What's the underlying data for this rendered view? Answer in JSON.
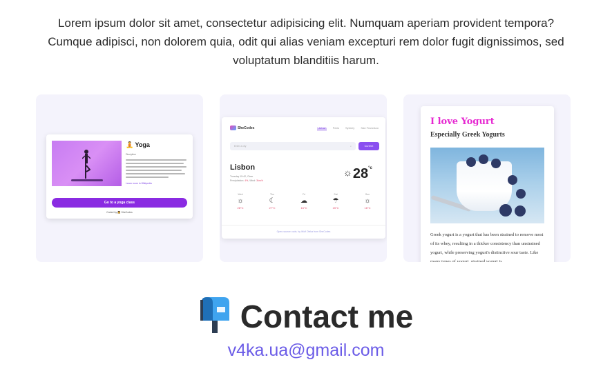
{
  "intro": {
    "text": "Lorem ipsum dolor sit amet, consectetur adipisicing elit. Numquam aperiam provident tempora? Cumque adipisci, non dolorem quia, odit qui alias veniam excepturi rem dolor fugit dignissimos, sed voluptatum blanditiis harum."
  },
  "projects": {
    "yoga": {
      "title": "🧘 Yoga",
      "subtitle": "Discipline",
      "link": "Learn more in Wikipedia",
      "button": "Go to a yoga class",
      "credit": "Coded by 👩 SheCodes"
    },
    "weather": {
      "logo": "SheCodes",
      "nav": [
        "Lisbon",
        "Paris",
        "Sydney",
        "San Francisco"
      ],
      "search_placeholder": "Enter a city",
      "current_button": "Current",
      "city": "Lisbon",
      "meta_line1": "Tuesday 15:42, Clear",
      "meta_line2_prefix": "Precipitation: ",
      "precipitation": "4%",
      "meta_line2_mid": ", Wind: ",
      "wind": "3km/h",
      "temperature": "28",
      "unit": "°c",
      "forecast": [
        {
          "day": "Wed",
          "icon": "☼",
          "temp": "28°C"
        },
        {
          "day": "Thu",
          "icon": "☾",
          "temp": "27°C"
        },
        {
          "day": "Fri",
          "icon": "☁",
          "temp": "16°C"
        },
        {
          "day": "Sat",
          "icon": "☂",
          "temp": "15°C"
        },
        {
          "day": "Sun",
          "icon": "☼",
          "temp": "16°C"
        }
      ],
      "footer": "Open-source code, by Wolf Oleka from SheCodes"
    },
    "yogurt": {
      "title": "I love Yogurt",
      "subtitle": "Especially Greek Yogurts",
      "text": "Greek yogurt is a yogurt that has been strained to remove most of its whey, resulting in a thicker consistency than unstrained yogurt, while preserving yogurt's distinctive sour taste. Like many types of yogurt, strained yogurt is"
    }
  },
  "contact": {
    "icon": "mailbox-icon",
    "title": "Contact me",
    "email": "v4ka.ua@gmail.com"
  },
  "colors": {
    "card_bg": "#f4f3fc",
    "accent_purple": "#8a2be2",
    "email_link": "#6b5ce7",
    "yogurt_title": "#e627d1"
  }
}
